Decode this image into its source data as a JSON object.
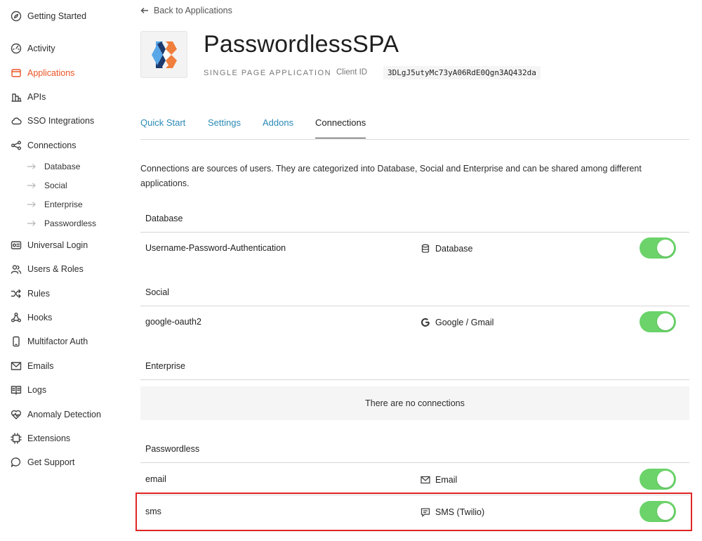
{
  "sidebar": {
    "items": [
      {
        "label": "Getting Started",
        "icon": "compass-icon"
      },
      {
        "label": "Activity",
        "icon": "gauge-icon"
      },
      {
        "label": "Applications",
        "icon": "applications-icon",
        "active": true
      },
      {
        "label": "APIs",
        "icon": "apis-icon"
      },
      {
        "label": "SSO Integrations",
        "icon": "cloud-icon"
      },
      {
        "label": "Connections",
        "icon": "connections-icon"
      },
      {
        "label": "Universal Login",
        "icon": "login-icon"
      },
      {
        "label": "Users & Roles",
        "icon": "users-icon"
      },
      {
        "label": "Rules",
        "icon": "shuffle-icon"
      },
      {
        "label": "Hooks",
        "icon": "hooks-icon"
      },
      {
        "label": "Multifactor Auth",
        "icon": "phone-icon"
      },
      {
        "label": "Emails",
        "icon": "mail-icon"
      },
      {
        "label": "Logs",
        "icon": "book-icon"
      },
      {
        "label": "Anomaly Detection",
        "icon": "heart-icon"
      },
      {
        "label": "Extensions",
        "icon": "chip-icon"
      },
      {
        "label": "Get Support",
        "icon": "chat-icon"
      }
    ],
    "connections_sub": [
      "Database",
      "Social",
      "Enterprise",
      "Passwordless"
    ]
  },
  "header": {
    "back_label": "Back to Applications",
    "app_name": "PasswordlessSPA",
    "app_type": "SINGLE PAGE APPLICATION",
    "client_id_label": "Client ID",
    "client_id": "3DLgJ5utyMc73yA06RdE0Qgn3AQ432da"
  },
  "tabs": [
    "Quick Start",
    "Settings",
    "Addons",
    "Connections"
  ],
  "active_tab": "Connections",
  "description": "Connections are sources of users. They are categorized into Database, Social and Enterprise and can be shared among different applications.",
  "sections": {
    "database": {
      "title": "Database",
      "rows": [
        {
          "name": "Username-Password-Authentication",
          "type": "Database",
          "icon": "database-icon",
          "enabled": true
        }
      ]
    },
    "social": {
      "title": "Social",
      "rows": [
        {
          "name": "google-oauth2",
          "type": "Google / Gmail",
          "icon": "google-icon",
          "enabled": true
        }
      ]
    },
    "enterprise": {
      "title": "Enterprise",
      "empty_text": "There are no connections"
    },
    "passwordless": {
      "title": "Passwordless",
      "rows": [
        {
          "name": "email",
          "type": "Email",
          "icon": "mail-icon",
          "enabled": true
        },
        {
          "name": "sms",
          "type": "SMS (Twilio)",
          "icon": "sms-icon",
          "enabled": true
        }
      ]
    }
  },
  "colors": {
    "accent": "#eb5424",
    "tab_link": "#2b8ab5",
    "toggle_on": "#6bd36a",
    "highlight": "#e02424"
  }
}
